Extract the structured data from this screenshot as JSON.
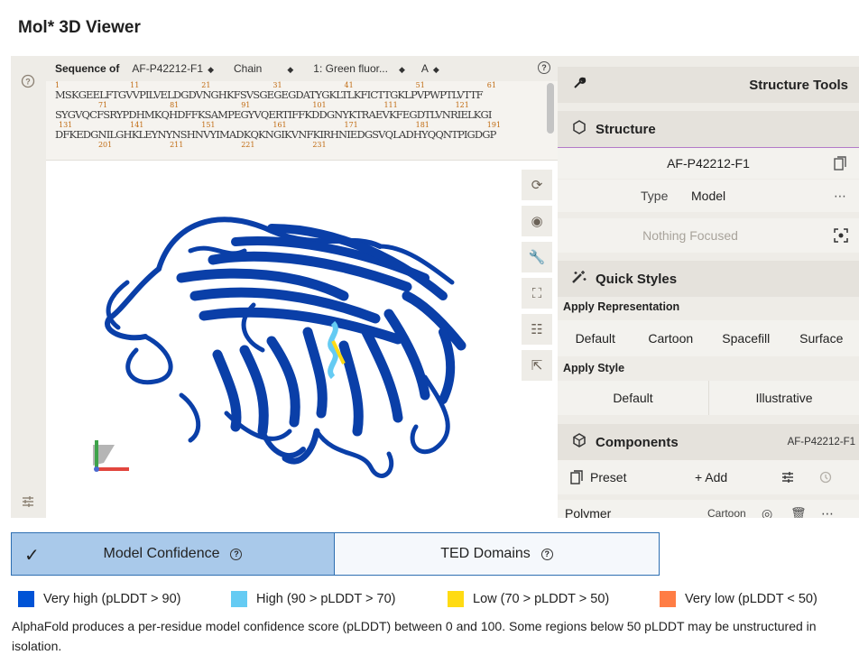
{
  "page_title": "Mol* 3D Viewer",
  "sequence": {
    "label": "Sequence of",
    "entry": "AF-P42212-F1",
    "mode": "Chain",
    "entity": "1: Green fluor...",
    "chain": "A",
    "blocks": [
      {
        "nums": [
          "1",
          "11",
          "21",
          "31",
          "41",
          "51",
          "61"
        ],
        "line": "MSKGEELFTGVVPILVELDGDVNGHKFSVSGEGEGDATYGKLTLKFICTTGKLPVPWPTLVTTF"
      },
      {
        "nums": [
          "71",
          "81",
          "91",
          "101",
          "111",
          "121"
        ],
        "line": "SYGVQCFSRYPDHMKQHDFFKSAMPEGYVQERTIFFKDDGNYKTRAEVKFEGDTLVNRIELKGI"
      },
      {
        "nums": [
          "131",
          "141",
          "151",
          "161",
          "171",
          "181",
          "191"
        ],
        "line": "DFKEDGNILGHKLEYNYNSHNVYIMADKQKNGIKVNFKIRHNIEDGSVQLADHYQQNTPIGDGP"
      },
      {
        "nums": [
          "201",
          "211",
          "221",
          "231"
        ],
        "line": ""
      }
    ]
  },
  "viewport_controls": [
    {
      "name": "reset-camera-icon",
      "glyph": "⟳"
    },
    {
      "name": "screenshot-icon",
      "glyph": "◉"
    },
    {
      "name": "wrench-icon",
      "glyph": "🔧"
    },
    {
      "name": "fullscreen-icon",
      "glyph": "⛶"
    },
    {
      "name": "settings-sliders-icon",
      "glyph": "☷"
    },
    {
      "name": "select-pointer-icon",
      "glyph": "⇱"
    }
  ],
  "right_panel": {
    "tools_title": "Structure Tools",
    "structure_header": "Structure",
    "structure_name": "AF-P42212-F1",
    "type_label": "Type",
    "type_value": "Model",
    "focus_text": "Nothing Focused",
    "quick_styles_header": "Quick Styles",
    "apply_representation": "Apply Representation",
    "representations": [
      "Default",
      "Cartoon",
      "Spacefill",
      "Surface"
    ],
    "apply_style": "Apply Style",
    "styles": [
      "Default",
      "Illustrative"
    ],
    "components_header": "Components",
    "components_entry": "AF-P42212-F1",
    "preset_label": "Preset",
    "add_label": "+ Add",
    "polymer_label": "Polymer",
    "polymer_repr": "Cartoon"
  },
  "tabs": [
    {
      "label": "Model Confidence",
      "active": true
    },
    {
      "label": "TED Domains",
      "active": false
    }
  ],
  "legend": [
    {
      "label": "Very high (pLDDT > 90)",
      "color": "#0053d6"
    },
    {
      "label": "High (90 > pLDDT > 70)",
      "color": "#65cbf3"
    },
    {
      "label": "Low (70 > pLDDT > 50)",
      "color": "#ffdb13"
    },
    {
      "label": "Very low (pLDDT < 50)",
      "color": "#ff7d45"
    }
  ],
  "description": "AlphaFold produces a per-residue model confidence score (pLDDT) between 0 and 100. Some regions below 50 pLDDT may be unstructured in isolation.",
  "colors": {
    "protein": "#0a3fa8",
    "accent": "#2e6fb2",
    "active_tab": "#a9c9ea"
  }
}
